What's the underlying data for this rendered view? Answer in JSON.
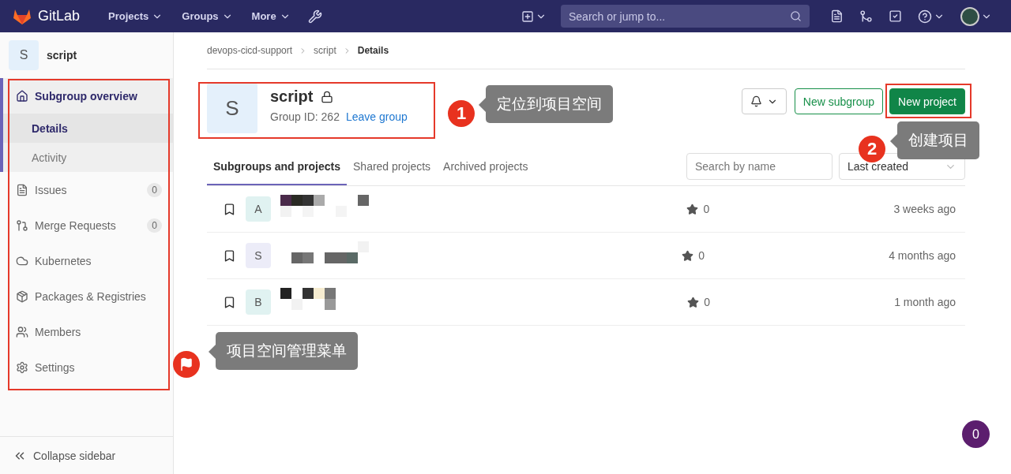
{
  "navbar": {
    "brand": "GitLab",
    "menus": [
      {
        "label": "Projects"
      },
      {
        "label": "Groups"
      },
      {
        "label": "More"
      }
    ],
    "search": {
      "placeholder": "Search or jump to..."
    }
  },
  "sidebar": {
    "avatar_letter": "S",
    "title": "script",
    "items": [
      {
        "label": "Subgroup overview",
        "kind": "home",
        "selected": true,
        "children": [
          {
            "label": "Details",
            "selected": true
          },
          {
            "label": "Activity",
            "selected": false
          }
        ]
      },
      {
        "label": "Issues",
        "kind": "issues",
        "count": "0",
        "selected": false
      },
      {
        "label": "Merge Requests",
        "kind": "merge",
        "count": "0",
        "selected": false
      },
      {
        "label": "Kubernetes",
        "kind": "cloud",
        "selected": false
      },
      {
        "label": "Packages & Registries",
        "kind": "package",
        "selected": false
      },
      {
        "label": "Members",
        "kind": "members",
        "selected": false
      },
      {
        "label": "Settings",
        "kind": "settings",
        "selected": false
      }
    ],
    "collapse": "Collapse sidebar"
  },
  "breadcrumb": [
    {
      "label": "devops-cicd-support",
      "current": false
    },
    {
      "label": "script",
      "current": false
    },
    {
      "label": "Details",
      "current": true
    }
  ],
  "group": {
    "avatar_letter": "S",
    "name": "script",
    "locked": true,
    "id_text": "Group ID: 262",
    "leave_link": "Leave group"
  },
  "buttons": [
    {
      "label": "New subgroup",
      "kind": "outline"
    },
    {
      "label": "New project",
      "kind": "primary"
    }
  ],
  "tabs": [
    {
      "label": "Subgroups and projects",
      "selected": true
    },
    {
      "label": "Shared projects",
      "selected": false
    },
    {
      "label": "Archived projects",
      "selected": false
    }
  ],
  "filter": {
    "search_placeholder": "Search by name",
    "sort": "Last created"
  },
  "projects": [
    {
      "avatar_letter": "A",
      "color": "#e0f2f1",
      "star_count": "0",
      "updated": "3 weeks ago"
    },
    {
      "avatar_letter": "S",
      "color": "#ececf8",
      "star_count": "0",
      "updated": "4 months ago"
    },
    {
      "avatar_letter": "B",
      "color": "#e0f2f1",
      "star_count": "0",
      "updated": "1 month ago"
    }
  ],
  "annotations": [
    {
      "kind": "number",
      "marker": "1",
      "text": "定位到项目空间"
    },
    {
      "kind": "number",
      "marker": "2",
      "text": "创建项目"
    },
    {
      "kind": "flag",
      "text": "项目空间管理菜单"
    }
  ],
  "badge": "0"
}
